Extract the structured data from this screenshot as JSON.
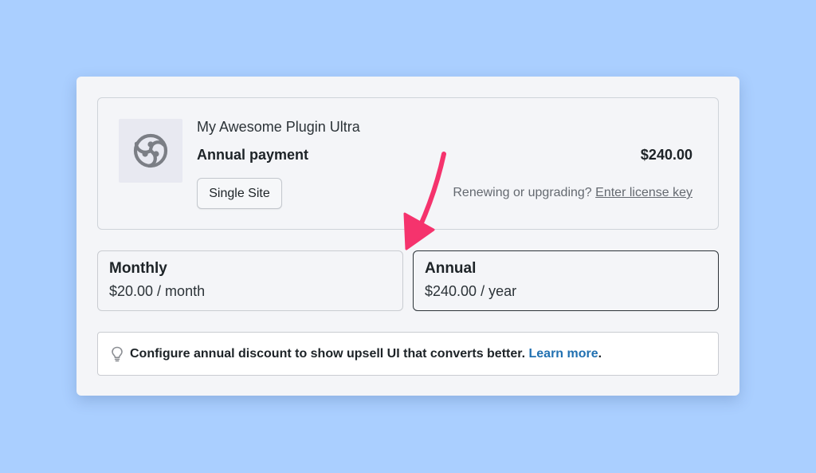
{
  "product": {
    "name": "My Awesome Plugin Ultra",
    "billing_label": "Annual payment",
    "price": "$240.00",
    "license_button": "Single Site",
    "renew_prompt": "Renewing or upgrading?",
    "renew_link": "Enter license key",
    "logo_icon": "plugin-logo-icon"
  },
  "plans": [
    {
      "title": "Monthly",
      "price": "$20.00 / month",
      "selected": false
    },
    {
      "title": "Annual",
      "price": "$240.00 / year",
      "selected": true
    }
  ],
  "notice": {
    "icon": "lightbulb-icon",
    "text": "Configure annual discount to show upsell UI that converts better.",
    "link": "Learn more",
    "suffix": "."
  },
  "colors": {
    "background": "#aacfff",
    "card": "#f4f5f8",
    "link": "#2271b1",
    "arrow": "#f5336d"
  }
}
